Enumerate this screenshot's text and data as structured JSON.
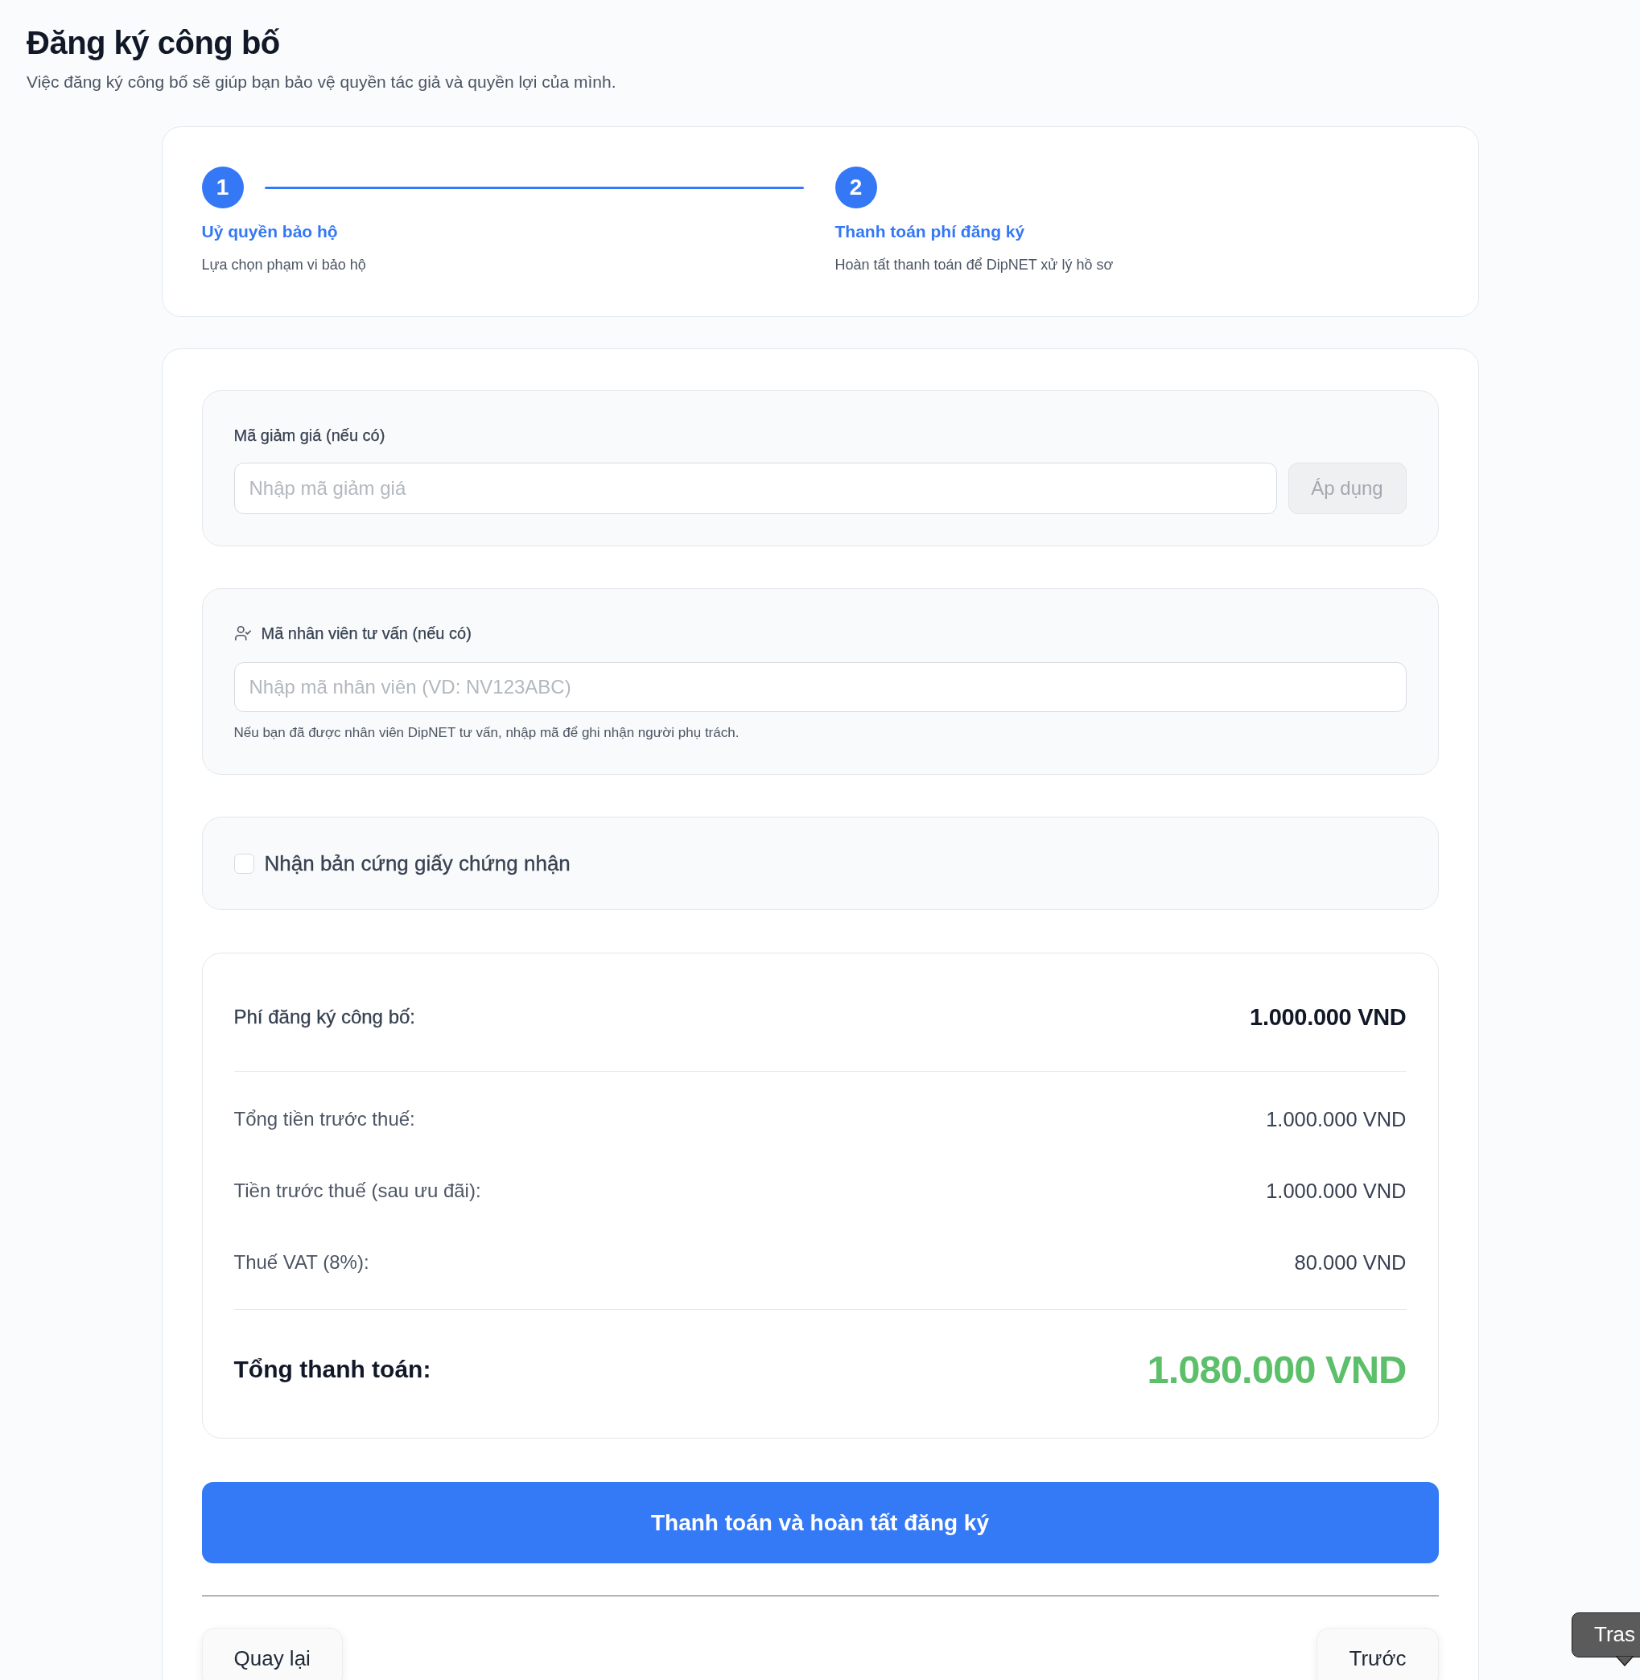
{
  "header": {
    "title": "Đăng ký công bố",
    "subtitle": "Việc đăng ký công bố sẽ giúp bạn bảo vệ quyền tác giả và quyền lợi của mình."
  },
  "stepper": {
    "steps": [
      {
        "number": "1",
        "title": "Uỷ quyền bảo hộ",
        "description": "Lựa chọn phạm vi bảo hộ",
        "active": true
      },
      {
        "number": "2",
        "title": "Thanh toán phí đăng ký",
        "description": "Hoàn tất thanh toán để DipNET xử lý hồ sơ",
        "active": true
      }
    ]
  },
  "discount": {
    "label": "Mã giảm giá (nếu có)",
    "placeholder": "Nhập mã giảm giá",
    "apply_button": {
      "label": "Áp dụng",
      "disabled": true
    }
  },
  "consultant": {
    "label": "Mã nhân viên tư vấn (nếu có)",
    "placeholder": "Nhập mã nhân viên (VD: NV123ABC)",
    "hint": "Nếu bạn đã được nhân viên DipNET tư vấn, nhập mã để ghi nhận người phụ trách."
  },
  "hard_copy": {
    "label": "Nhận bản cứng giấy chứng nhận",
    "checked": false
  },
  "summary": {
    "fee": {
      "label": "Phí đăng ký công bố:",
      "value": "1.000.000 VND"
    },
    "details": [
      {
        "label": "Tổng tiền trước thuế:",
        "value": "1.000.000 VND"
      },
      {
        "label": "Tiền trước thuế (sau ưu đãi):",
        "value": "1.000.000 VND"
      },
      {
        "label": "Thuế VAT (8%):",
        "value": "80.000 VND"
      }
    ],
    "total": {
      "label": "Tổng thanh toán:",
      "value": "1.080.000 VND"
    }
  },
  "submit_button": "Thanh toán và hoàn tất đăng ký",
  "nav": {
    "back": "Quay lại",
    "previous": "Trước"
  },
  "dock_tooltip": "Tras"
}
